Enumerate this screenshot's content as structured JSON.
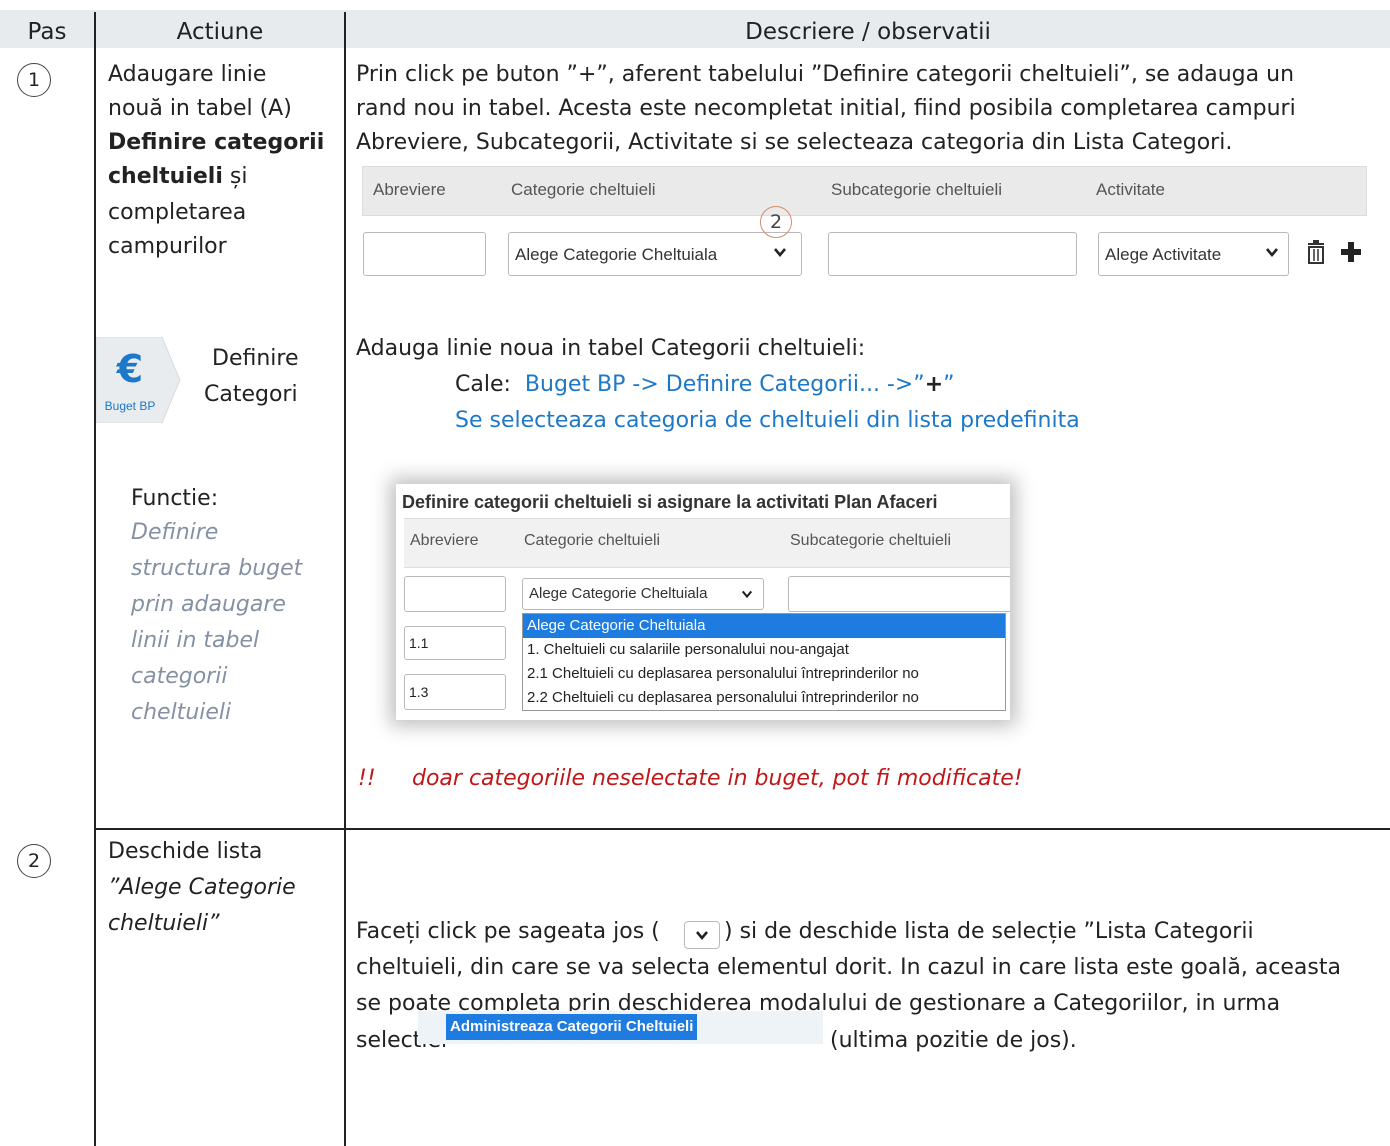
{
  "header": {
    "col_pas": "Pas",
    "col_actiune": "Actiune",
    "col_descriere": "Descriere / observatii"
  },
  "step1": {
    "number": "1",
    "actiune_lines": [
      "Adaugare linie",
      "nouă in tabel  (A)"
    ],
    "actiune_bold_1": "Definire categorii",
    "actiune_bold_2": "cheltuieli",
    "actiune_si": " și",
    "actiune_tail": [
      "completarea",
      "campurilor"
    ],
    "desc_lines": [
      "Prin click pe buton ”+”, aferent tabelului ”Definire categorii cheltuieli”, se adauga un",
      "rand nou in tabel. Acesta este necompletat initial, fiind posibila completarea campuri",
      "Abreviere, Subcategorii, Activitate si se selecteaza categoria din Lista Categori."
    ],
    "mock_table": {
      "col_abreviere": "Abreviere",
      "col_categorie": "Categorie cheltuieli",
      "col_subcategorie": "Subcategorie cheltuieli",
      "col_activitate": "Activitate",
      "select_categorie": "Alege Categorie Cheltuiala",
      "select_activitate": "Alege Activitate",
      "callout_number": "2"
    },
    "menu_button": {
      "symbol": "€",
      "label": "Buget BP"
    },
    "menu_text": [
      "Definire",
      "Categori"
    ],
    "functie_label": "Functie:",
    "functie_lines": [
      "Definire",
      "structura buget",
      "prin adaugare",
      "linii in tabel",
      "categorii",
      "cheltuieli"
    ],
    "adauga_title": "Adauga  linie noua in tabel Categorii cheltuieli:",
    "cale_label": "Cale:",
    "cale_path": "Buget BP -> Definire Categorii...  ->”",
    "cale_plus": "+",
    "cale_end": "”",
    "cale_note": "Se selecteaza categoria de cheltuieli din lista predefinita",
    "screenshot": {
      "title": "Definire categorii cheltuieli si asignare la activitati Plan Afaceri",
      "col_abreviere": "Abreviere",
      "col_categorie": "Categorie cheltuieli",
      "col_subcategorie": "Subcategorie cheltuieli",
      "select_value": "Alege Categorie Cheltuiala",
      "row_values": [
        "1.1",
        "1.3"
      ],
      "options": [
        "Alege Categorie Cheltuiala",
        "1. Cheltuieli cu salariile personalului nou-angajat",
        "2.1 Cheltuieli cu deplasarea personalului întreprinderilor no",
        "2.2 Cheltuieli cu deplasarea personalului întreprinderilor no"
      ]
    },
    "warning_mark": "!!",
    "warning_text": "doar categoriile neselectate in buget, pot fi modificate!"
  },
  "step2": {
    "number": "2",
    "actiune_line1": "Deschide lista",
    "actiune_it1": "”Alege Categorie",
    "actiune_it2": "cheltuieli”",
    "desc_pre": "Faceți click pe sageata jos (",
    "desc_post": ") si de deschide lista de selecție ”Lista Categorii",
    "desc_lines": [
      "cheltuieli, din care se va selecta elementul dorit. In cazul in care lista este goală, aceasta",
      "se poate completa prin deschiderea modalului de gestionare a Categoriilor, in urma"
    ],
    "desc_selectiei": "selectiei",
    "admin_button": "Administreaza Categorii Cheltuieli",
    "desc_end": "(ultima pozitie de jos)."
  }
}
